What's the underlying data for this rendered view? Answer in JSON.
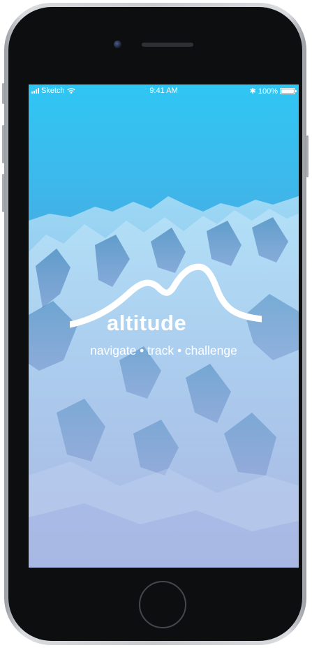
{
  "status_bar": {
    "carrier": "Sketch",
    "time": "9:41 AM",
    "bluetooth": "✱",
    "battery_percent": "100%",
    "battery_level": 1.0
  },
  "splash": {
    "brand_name": "altitude",
    "tagline": "navigate • track • challenge"
  },
  "icons": {
    "signal": "signal-bars-icon",
    "wifi": "wifi-icon",
    "bluetooth": "bluetooth-icon",
    "battery": "battery-icon",
    "logo": "mountain-logo-icon"
  },
  "colors": {
    "sky_top": "#2fc6f3",
    "sky_bottom": "#7584c6",
    "text": "#ffffff",
    "bezel": "#0d0e10"
  }
}
